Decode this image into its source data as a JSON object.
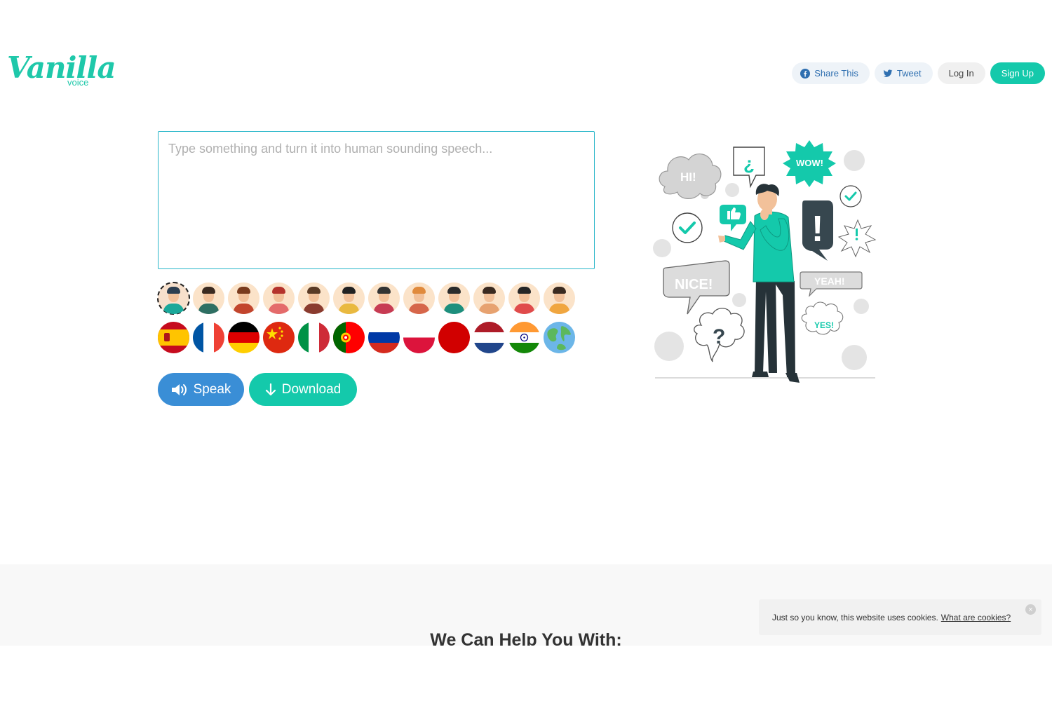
{
  "brand": {
    "logo_script": "Vanilla",
    "logo_sub": "voice",
    "color": "#1fc8aa"
  },
  "nav": {
    "share_label": "Share This",
    "tweet_label": "Tweet",
    "login_label": "Log In",
    "signup_label": "Sign Up"
  },
  "editor": {
    "placeholder": "Type something and turn it into human sounding speech...",
    "value": ""
  },
  "voices": [
    {
      "name": "voice-1",
      "hair": "#2c3e50",
      "shirt": "#1aa89a",
      "selected": true
    },
    {
      "name": "voice-2",
      "hair": "#3b2a20",
      "shirt": "#2e6f63",
      "selected": false
    },
    {
      "name": "voice-3",
      "hair": "#7a3b1d",
      "shirt": "#c2452d",
      "selected": false
    },
    {
      "name": "voice-4",
      "hair": "#b4332c",
      "shirt": "#e46b6b",
      "selected": false
    },
    {
      "name": "voice-5",
      "hair": "#5a3b26",
      "shirt": "#8a3b2f",
      "selected": false
    },
    {
      "name": "voice-6",
      "hair": "#222222",
      "shirt": "#e9b940",
      "selected": false
    },
    {
      "name": "voice-7",
      "hair": "#333333",
      "shirt": "#c73b53",
      "selected": false
    },
    {
      "name": "voice-8",
      "hair": "#e08a3c",
      "shirt": "#d6664a",
      "selected": false
    },
    {
      "name": "voice-9",
      "hair": "#2b2b2b",
      "shirt": "#1d8f7d",
      "selected": false
    },
    {
      "name": "voice-10",
      "hair": "#3a2a20",
      "shirt": "#e7a270",
      "selected": false
    },
    {
      "name": "voice-11",
      "hair": "#262626",
      "shirt": "#e04b4b",
      "selected": false
    },
    {
      "name": "voice-12",
      "hair": "#3a2a20",
      "shirt": "#f0a640",
      "selected": false
    }
  ],
  "languages": [
    {
      "name": "spanish-flag"
    },
    {
      "name": "french-flag"
    },
    {
      "name": "german-flag"
    },
    {
      "name": "chinese-flag"
    },
    {
      "name": "italian-flag"
    },
    {
      "name": "portuguese-flag"
    },
    {
      "name": "russian-flag"
    },
    {
      "name": "polish-flag"
    },
    {
      "name": "japanese-flag"
    },
    {
      "name": "dutch-flag"
    },
    {
      "name": "indian-flag"
    },
    {
      "name": "globe"
    }
  ],
  "actions": {
    "speak_label": "Speak",
    "download_label": "Download"
  },
  "illustration": {
    "bubble_hi": "HI!",
    "bubble_wow": "WOW!",
    "bubble_nice": "NICE!",
    "bubble_yeah": "YEAH!",
    "bubble_yes": "YES!",
    "bubble_question": "?",
    "bubble_inverted_question": "¿",
    "bubble_exclaim": "!"
  },
  "section": {
    "title": "We Can Help You With:"
  },
  "cookie": {
    "text": "Just so you know, this website uses cookies.",
    "link": "What are cookies?",
    "close": "×"
  }
}
